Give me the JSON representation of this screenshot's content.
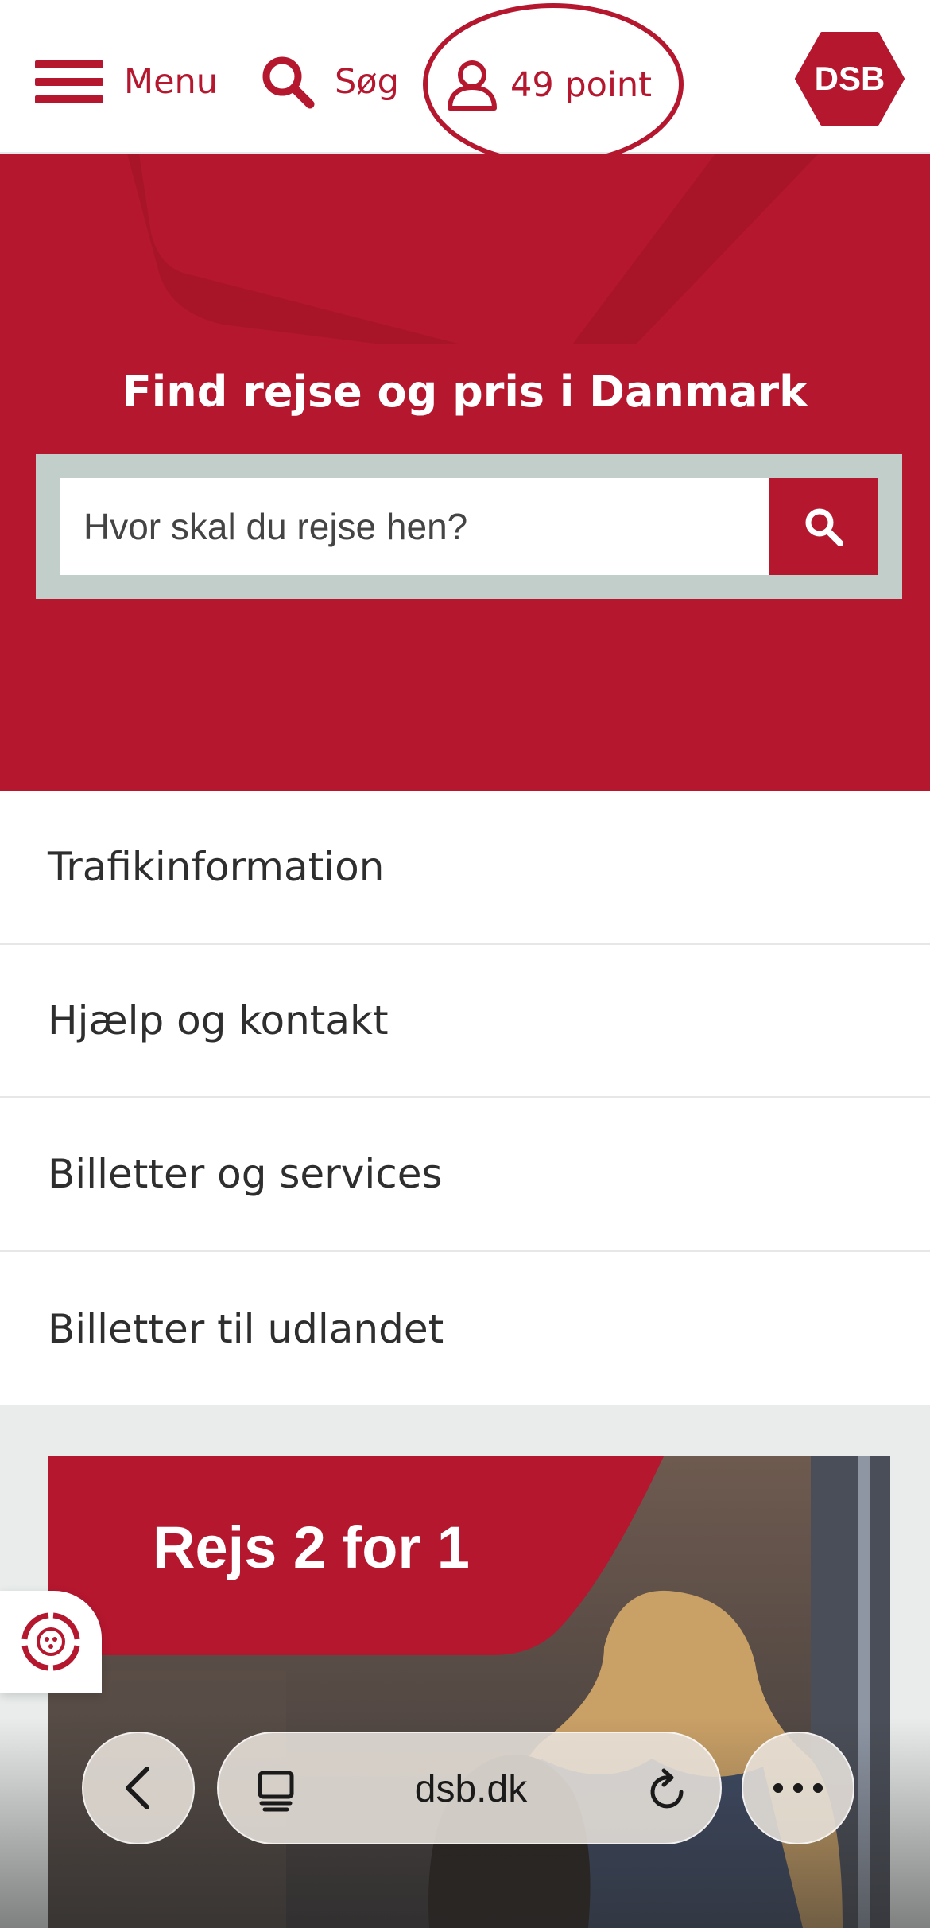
{
  "header": {
    "menu_label": "Menu",
    "search_label": "Søg",
    "points_label": "49 point",
    "logo_text": "DSB"
  },
  "hero": {
    "title": "Find rejse og pris i Danmark",
    "search_placeholder": "Hvor skal du rejse hen?"
  },
  "nav": {
    "items": [
      {
        "label": "Trafikinformation"
      },
      {
        "label": "Hjælp og kontakt"
      },
      {
        "label": "Billetter og services"
      },
      {
        "label": "Billetter til udlandet"
      }
    ]
  },
  "promo": {
    "title": "Rejs 2 for 1"
  },
  "browser": {
    "url": "dsb.dk"
  },
  "colors": {
    "brand_red": "#b5172f",
    "search_frame": "#c1cec9",
    "page_bg": "#e9eceb"
  },
  "icons": {
    "menu": "hamburger-icon",
    "search": "search-icon",
    "user": "user-icon",
    "feedback": "feedback-icon",
    "back": "chevron-left-icon",
    "tabs": "tabs-icon",
    "reload": "reload-icon",
    "more": "more-icon"
  }
}
